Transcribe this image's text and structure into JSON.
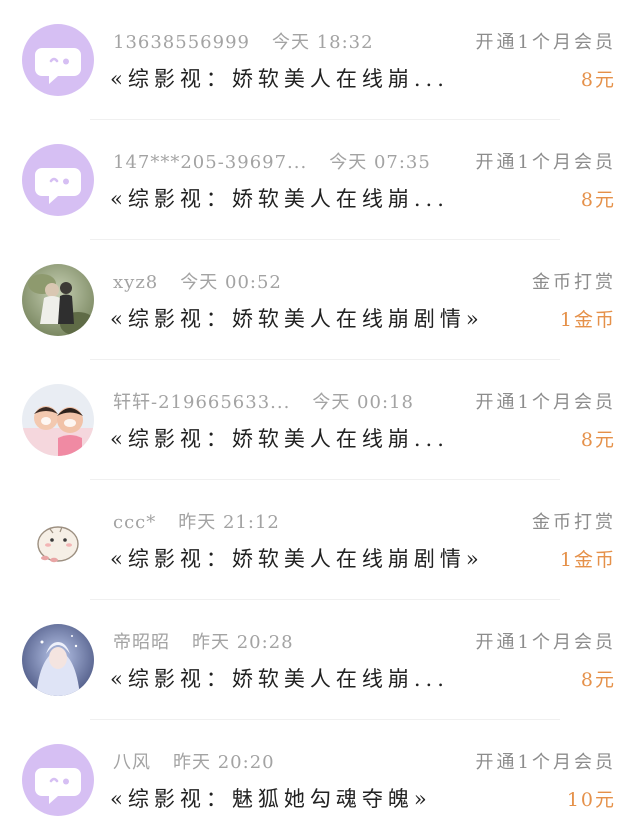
{
  "colors": {
    "accent_amount": "#e5914a",
    "default_avatar": "#d6bff3",
    "meta_gray": "#a3a3a3",
    "title_dark": "#222222"
  },
  "items": [
    {
      "avatar": "default-chat-bubble-avatar",
      "user": "13638556999",
      "time": "今天 18:32",
      "title": "«综影视：娇软美人在线崩...",
      "action": "开通1个月会员",
      "amount": "8元"
    },
    {
      "avatar": "default-chat-bubble-avatar",
      "user": "147***205-39697...",
      "time": "今天 07:35",
      "title": "«综影视：娇软美人在线崩...",
      "action": "开通1个月会员",
      "amount": "8元"
    },
    {
      "avatar": "photo-couple-avatar",
      "user": "xyz8",
      "time": "今天 00:52",
      "title": "«综影视：娇软美人在线崩剧情»",
      "action": "金币打赏",
      "amount": "1金币"
    },
    {
      "avatar": "photo-children-avatar",
      "user": "轩轩-219665633...",
      "time": "今天 00:18",
      "title": "«综影视：娇软美人在线崩...",
      "action": "开通1个月会员",
      "amount": "8元"
    },
    {
      "avatar": "cartoon-hamster-avatar",
      "user": "ccc*",
      "time": "昨天 21:12",
      "title": "«综影视：娇软美人在线崩剧情»",
      "action": "金币打赏",
      "amount": "1金币"
    },
    {
      "avatar": "anime-girl-avatar",
      "user": "帝昭昭",
      "time": "昨天 20:28",
      "title": "«综影视：娇软美人在线崩...",
      "action": "开通1个月会员",
      "amount": "8元"
    },
    {
      "avatar": "default-chat-bubble-avatar",
      "user": "八风",
      "time": "昨天 20:20",
      "title": "«综影视：魅狐她勾魂夺魄»",
      "action": "开通1个月会员",
      "amount": "10元"
    }
  ]
}
